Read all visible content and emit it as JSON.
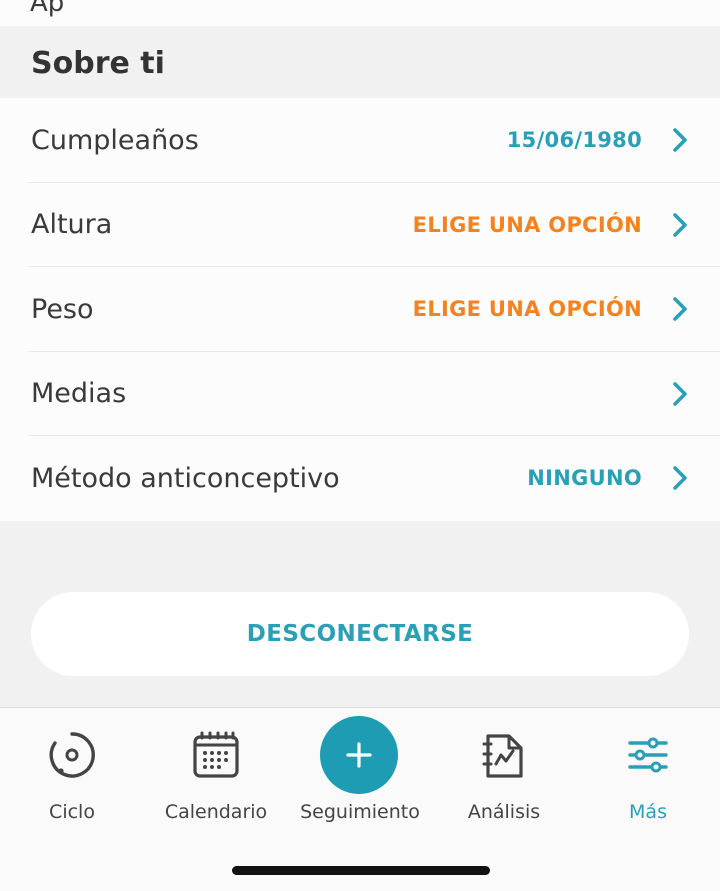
{
  "section": {
    "title": "Sobre ti"
  },
  "rows": [
    {
      "label": "Cumpleaños",
      "value": "15/06/1980",
      "value_color": "#2a9fb5"
    },
    {
      "label": "Altura",
      "value": "ELIGE UNA OPCIÓN",
      "value_color": "#f3821f"
    },
    {
      "label": "Peso",
      "value": "ELIGE UNA OPCIÓN",
      "value_color": "#f3821f"
    },
    {
      "label": "Medias",
      "value": "",
      "value_color": "#2a9fb5"
    },
    {
      "label": "Método anticonceptivo",
      "value": "NINGUNO",
      "value_color": "#2a9fb5"
    }
  ],
  "logout_button": {
    "label": "DESCONECTARSE"
  },
  "tabbar": {
    "active_tab": "Más",
    "tabs": [
      {
        "label": "Ciclo",
        "icon": "cycle-icon"
      },
      {
        "label": "Calendario",
        "icon": "calendar-icon"
      },
      {
        "label": "Seguimiento",
        "icon": "plus-icon"
      },
      {
        "label": "Análisis",
        "icon": "analysis-icon"
      },
      {
        "label": "Más",
        "icon": "sliders-icon"
      }
    ]
  },
  "colors": {
    "accent": "#2a9fb5",
    "warning": "#f3821f",
    "background": "#f1f1f1"
  }
}
